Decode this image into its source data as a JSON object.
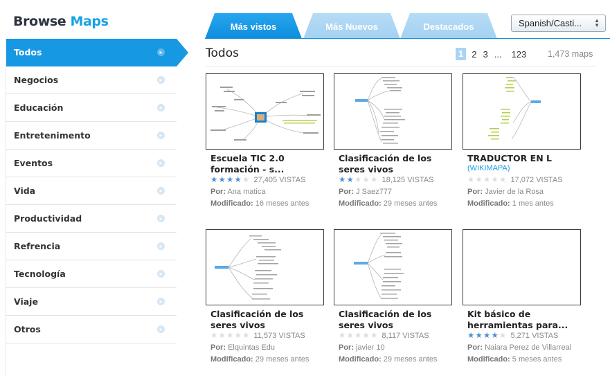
{
  "header": {
    "logo_browse": "Browse",
    "logo_maps": "Maps",
    "tabs": [
      "Más vistos",
      "Más Nuevos",
      "Destacados"
    ],
    "language": "Spanish/Casti..."
  },
  "sidebar": {
    "items": [
      {
        "label": "Todos"
      },
      {
        "label": "Negocios"
      },
      {
        "label": "Educación"
      },
      {
        "label": "Entretenimento"
      },
      {
        "label": "Eventos"
      },
      {
        "label": "Vida"
      },
      {
        "label": "Productividad"
      },
      {
        "label": "Refrencia"
      },
      {
        "label": "Tecnología"
      },
      {
        "label": "Viaje"
      },
      {
        "label": "Otros"
      }
    ]
  },
  "content": {
    "title": "Todos",
    "pager": {
      "current": "1",
      "p2": "2",
      "p3": "3",
      "ellipsis": "...",
      "last": "123"
    },
    "count": "1,473 maps",
    "by_label": "Por:",
    "modified_label": "Modificado:"
  },
  "cards": [
    {
      "title": "Escuela TIC 2.0 formación - s...",
      "wiki": "",
      "rating": 4,
      "views": "27,405 VISTAS",
      "author": "Ana matica",
      "modified": "16 meses antes"
    },
    {
      "title": "Clasificación de los seres vivos",
      "wiki": "",
      "rating": 2,
      "views": "18,125 VISTAS",
      "author": "J Saez777",
      "modified": "29 meses antes"
    },
    {
      "title": "TRADUCTOR EN L",
      "wiki": "(WIKIMAPA)",
      "rating": 0,
      "views": "17,072 VISTAS",
      "author": "Javier de la Rosa",
      "modified": "1 mes antes"
    },
    {
      "title": "Clasificación de los seres vivos",
      "wiki": "",
      "rating": 0,
      "views": "11,573 VISTAS",
      "author": "Elquintas Edu",
      "modified": "29 meses antes"
    },
    {
      "title": "Clasificación de los seres vivos",
      "wiki": "",
      "rating": 0,
      "views": "8,117 VISTAS",
      "author": "javier 10",
      "modified": "29 meses antes"
    },
    {
      "title": "Kit básico de herramientas para...",
      "wiki": "",
      "rating": 4,
      "views": "5,271 VISTAS",
      "author": "Naiara Perez de Villarreal",
      "modified": "5 meses antes"
    }
  ],
  "colors": {
    "accent": "#1698e3",
    "tab_inactive": "#a4d1f2",
    "star_on": "#4b8fd0",
    "star_off": "#d9dde2",
    "wiki_link": "#19a0e8"
  }
}
